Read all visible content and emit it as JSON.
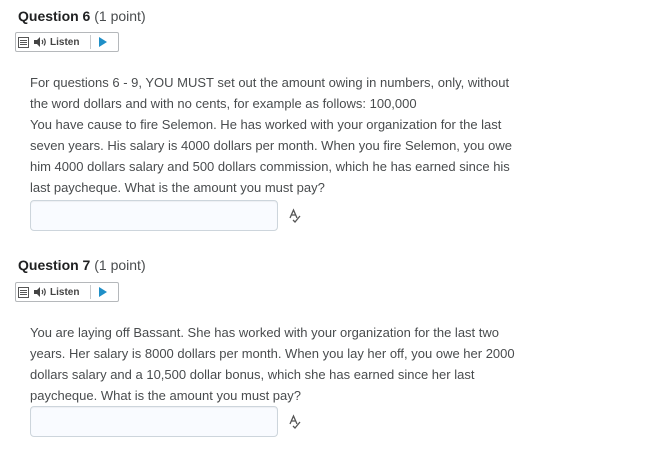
{
  "questions": [
    {
      "number": "Question 6",
      "points": "(1 point)",
      "listen_label": "Listen",
      "lines": [
        "For questions 6 - 9, YOU MUST set out the amount owing in numbers, only, without",
        "the word dollars and with no cents, for example as follows: 100,000",
        "You have cause to fire Selemon. He has worked with your organization for the last",
        "seven years. His salary is 4000 dollars per month. When you fire Selemon, you owe",
        "him 4000 dollars salary and 500 dollars commission, which he has earned since his",
        "last paycheque. What is the amount you must pay?"
      ],
      "answer_value": ""
    },
    {
      "number": "Question 7",
      "points": "(1 point)",
      "listen_label": "Listen",
      "lines": [
        "You are laying off Bassant. She has worked with your organization for the last two",
        "years. Her salary is 8000 dollars per month. When you lay her off, you owe her 2000",
        "dollars salary and a 10,500 dollar bonus, which she has earned since her last",
        "paycheque. What is the amount you must pay?"
      ],
      "answer_value": ""
    }
  ],
  "colors": {
    "accent": "#1f8fc7",
    "text": "#494c4e",
    "title": "#202122",
    "input_border": "#cdd5dc"
  },
  "icons": [
    "menu-icon",
    "speaker-icon",
    "play-icon",
    "spellcheck-icon"
  ]
}
